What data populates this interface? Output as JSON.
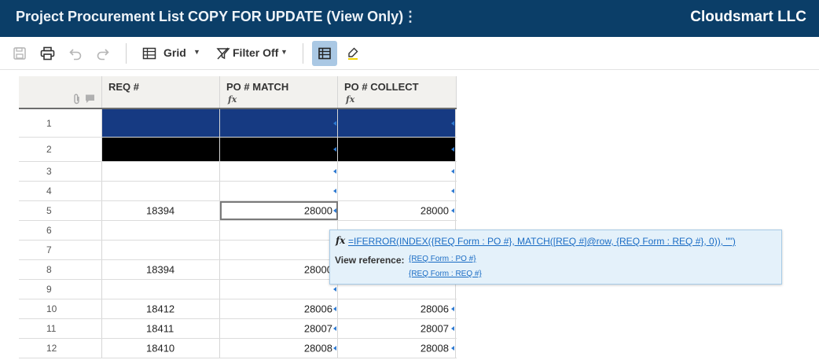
{
  "titlebar": {
    "title": "Project Procurement List COPY FOR UPDATE (View Only)",
    "menu_glyph": "⋮",
    "brand": "Cloudsmart LLC"
  },
  "toolbar": {
    "view_label": "Grid",
    "filter_label": "Filter Off",
    "icons": [
      "save-icon",
      "print-icon",
      "undo-icon",
      "redo-icon",
      "grid-icon",
      "filter-icon",
      "grid-view-icon",
      "highlight-icon"
    ]
  },
  "columns": [
    {
      "label": "REQ #",
      "formula": ""
    },
    {
      "label": "PO # MATCH",
      "formula": "fx"
    },
    {
      "label": "PO # COLLECT",
      "formula": "fx"
    }
  ],
  "rows": [
    {
      "num": "1",
      "req": "",
      "match": "",
      "collect": ""
    },
    {
      "num": "2",
      "req": "",
      "match": "",
      "collect": ""
    },
    {
      "num": "3",
      "req": "",
      "match": "",
      "collect": ""
    },
    {
      "num": "4",
      "req": "",
      "match": "",
      "collect": ""
    },
    {
      "num": "5",
      "req": "18394",
      "match": "28000",
      "collect": "28000"
    },
    {
      "num": "6",
      "req": "",
      "match": "",
      "collect": ""
    },
    {
      "num": "7",
      "req": "",
      "match": "",
      "collect": ""
    },
    {
      "num": "8",
      "req": "18394",
      "match": "28000",
      "collect": ""
    },
    {
      "num": "9",
      "req": "",
      "match": "",
      "collect": ""
    },
    {
      "num": "10",
      "req": "18412",
      "match": "28006",
      "collect": "28006"
    },
    {
      "num": "11",
      "req": "18411",
      "match": "28007",
      "collect": "28007"
    },
    {
      "num": "12",
      "req": "18410",
      "match": "28008",
      "collect": "28008"
    }
  ],
  "tooltip": {
    "fx_glyph": "fx",
    "formula": "=IFERROR(INDEX({REQ Form : PO #}, MATCH([REQ #]@row, {REQ Form : REQ #}, 0)), \"\")",
    "view_reference_label": "View reference:",
    "ref1": "{REQ Form : PO #}",
    "ref2": "{REQ Form : REQ #}"
  },
  "colors": {
    "titlebar": "#0b3e68",
    "row1_fill": "#163a82",
    "row2_fill": "#000000",
    "accent": "#2e7ad1"
  }
}
